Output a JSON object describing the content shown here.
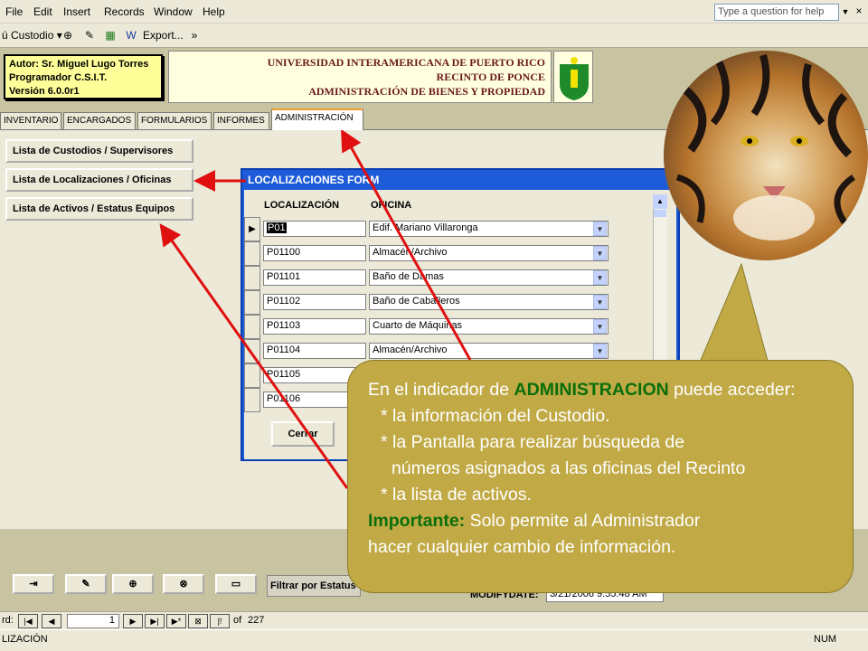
{
  "menu": {
    "file": "File",
    "edit": "Edit",
    "insert": "Insert",
    "records": "Records",
    "window": "Window",
    "help": "Help",
    "help_box": "Type a question for help",
    "win_buttons": [
      "_",
      "□",
      "×"
    ]
  },
  "toolbar": {
    "custodio": "ú Custodio ▾",
    "export": "Export..."
  },
  "header": {
    "author": "Autor:  Sr. Miguel Lugo Torres",
    "programmer": "Programador C.S.I.T.",
    "version": "Versión 6.0.0r1",
    "university": "UNIVERSIDAD INTERAMERICANA DE PUERTO RICO",
    "campus": "RECINTO DE PONCE",
    "department": "ADMINISTRACIÓN DE BIENES Y PROPIEDAD"
  },
  "tabs": [
    "INVENTARIO",
    "ENCARGADOS",
    "FORMULARIOS",
    "INFORMES",
    "ADMINISTRACIÓN"
  ],
  "admin_buttons": [
    "Lista de Custodios / Supervisores",
    "Lista de Localizaciones / Oficinas",
    "Lista de Activos / Estatus Equipos"
  ],
  "form": {
    "title": "LOCALIZACIONES FORM",
    "col_localizacion": "LOCALIZACIÓN",
    "col_oficina": "OFICINA",
    "rows": [
      {
        "loc": "P01",
        "oficina": "Edif. Mariano Villaronga"
      },
      {
        "loc": "P01100",
        "oficina": "Almacén/Archivo"
      },
      {
        "loc": "P01101",
        "oficina": "Baño de Damas"
      },
      {
        "loc": "P01102",
        "oficina": "Baño de Caballeros"
      },
      {
        "loc": "P01103",
        "oficina": "Cuarto de Máquinas"
      },
      {
        "loc": "P01104",
        "oficina": "Almacén/Archivo"
      },
      {
        "loc": "P01105",
        "oficina": ""
      },
      {
        "loc": "P01106",
        "oficina": ""
      }
    ],
    "close_button": "Cerrar"
  },
  "bottom": {
    "filter": "Filtrar por Estatus",
    "modify_label": "MODIFYDATE:",
    "modify_value": "3/21/2006 9:55:48 AM"
  },
  "nav": {
    "label": "rd:",
    "record": "1",
    "of": "of",
    "total": "227"
  },
  "status": {
    "left": "LIZACIÓN",
    "num": "NUM"
  },
  "callout": {
    "intro_pre": "En el indicador de ",
    "intro_bold": "ADMINISTRACION",
    "intro_post": " puede acceder:",
    "item1": "* la información del Custodio.",
    "item2a": "* la Pantalla para realizar búsqueda de",
    "item2b": "números asignados a las oficinas del Recinto",
    "item3": "* la lista de activos.",
    "important_label": "Importante:",
    "important_text": "  Solo permite al Administrador",
    "important_text2": "hacer cualquier cambio de información."
  },
  "colors": {
    "form_title_bar": "#1d5bd8",
    "callout": "#c1aa46",
    "highlight_green": "#0a6e0a",
    "arrow_red": "#e01010"
  }
}
